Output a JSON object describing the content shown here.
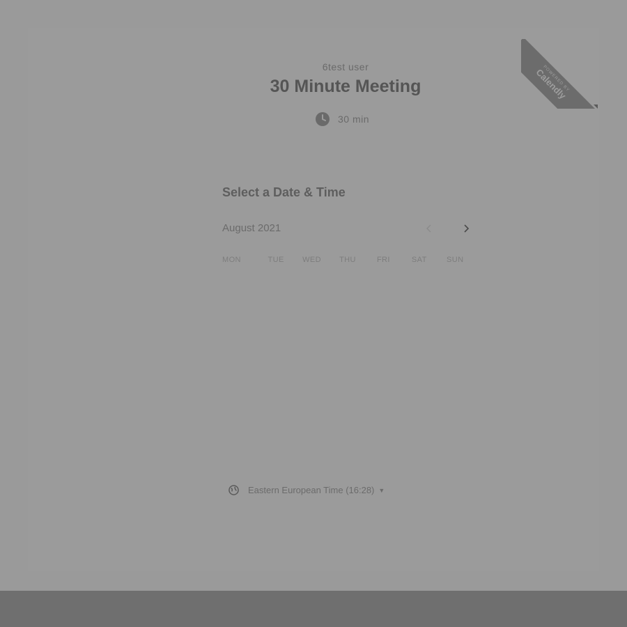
{
  "header": {
    "organizer": "6test user",
    "title": "30 Minute Meeting",
    "duration": "30 min"
  },
  "ribbon": {
    "small": "POWERED BY",
    "brand": "Calendly"
  },
  "calendar": {
    "section_title": "Select a Date & Time",
    "month": "August 2021",
    "weekdays": [
      "MON",
      "TUE",
      "WED",
      "THU",
      "FRI",
      "SAT",
      "SUN"
    ]
  },
  "timezone": {
    "label": "Eastern European Time (16:28)"
  },
  "icons": {
    "duration": "clock-icon",
    "timezone": "globe-icon",
    "prev": "chevron-left-icon",
    "next": "chevron-right-icon"
  }
}
